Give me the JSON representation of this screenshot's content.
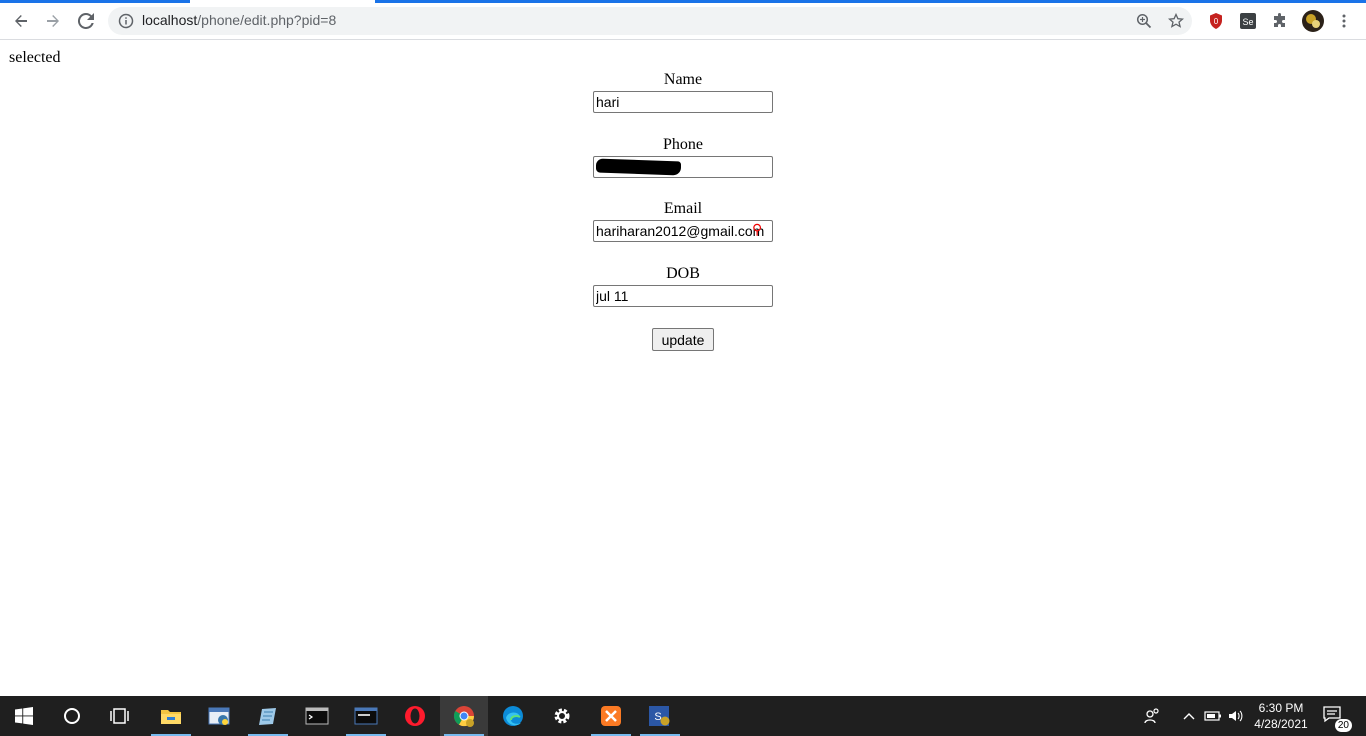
{
  "browser": {
    "url_host": "localhost",
    "url_path": "/phone/edit.php?pid=8"
  },
  "page": {
    "status_text": "selected",
    "fields": [
      {
        "label": "Name",
        "value": "hari"
      },
      {
        "label": "Phone",
        "value": ""
      },
      {
        "label": "Email",
        "value": "hariharan2012@gmail.com"
      },
      {
        "label": "DOB",
        "value": "jul 11"
      }
    ],
    "update_label": "update"
  },
  "taskbar": {
    "time": "6:30 PM",
    "date": "4/28/2021",
    "notification_count": "20"
  },
  "colors": {
    "accent": "#1a73e8",
    "taskbar": "#1f1f1f"
  }
}
